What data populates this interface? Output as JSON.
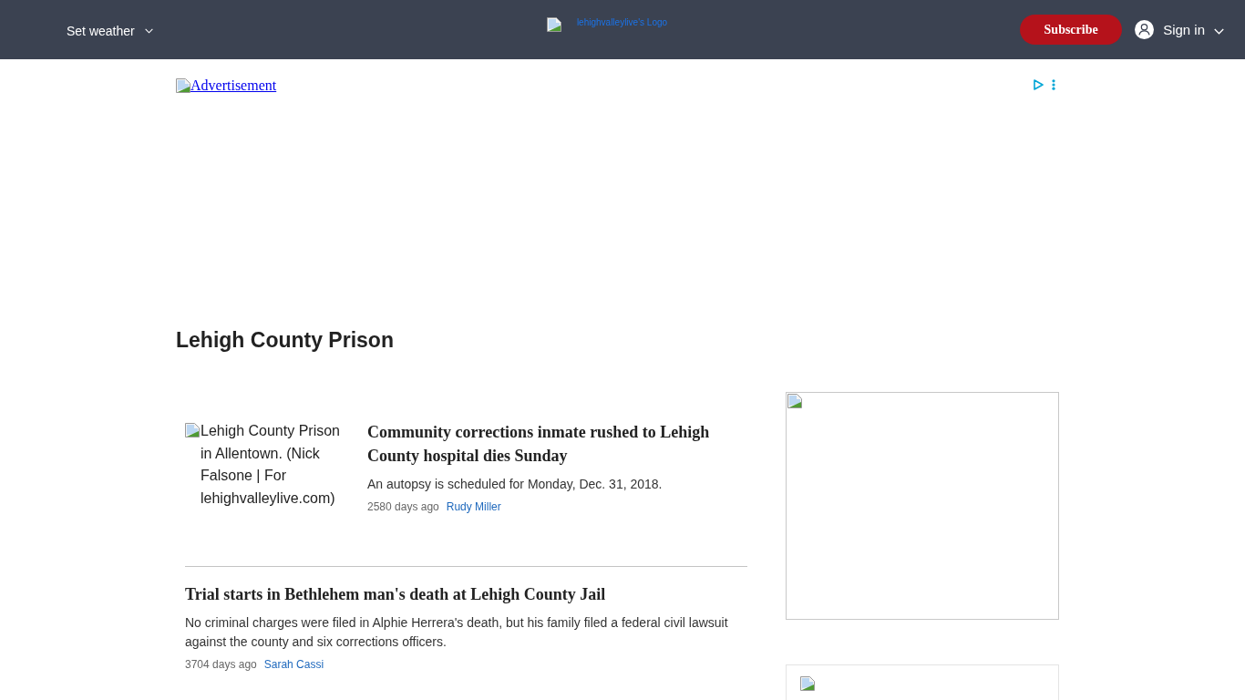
{
  "header": {
    "weather_button": "Set weather",
    "logo_alt": "lehighvalleylive's Logo",
    "subscribe_button": "Subscribe",
    "sign_in_button": "Sign in"
  },
  "ad_banner": {
    "label": "Advertisement"
  },
  "page_title": "Lehigh County Prison",
  "articles": [
    {
      "kind": "image",
      "image_alt": "Lehigh County Prison in Allentown. (Nick Falsone | For lehighvalleylive.com)",
      "headline": "Community corrections inmate rushed to Lehigh County hospital dies Sunday",
      "summary": "An autopsy is scheduled for Monday, Dec. 31, 2018.",
      "age": "2580 days ago",
      "author": "Rudy Miller"
    },
    {
      "kind": "text",
      "headline": "Trial starts in Bethlehem man's death at Lehigh County Jail",
      "summary": "No criminal charges were filed in Alphie Herrera's death, but his family filed a federal civil lawsuit against the county and six corrections officers.",
      "age": "3704 days ago",
      "author": "Sarah Cassi"
    }
  ],
  "sidebar": {
    "ad_slots": [
      {
        "kind": "frame"
      },
      {
        "kind": "card"
      }
    ]
  }
}
